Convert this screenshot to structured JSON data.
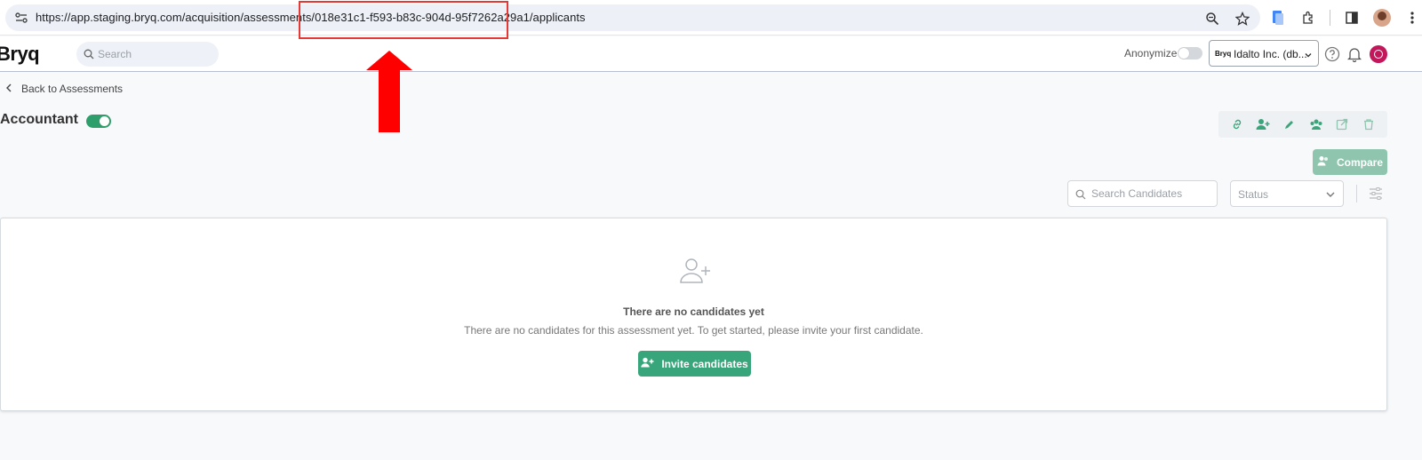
{
  "browser": {
    "url": "https://app.staging.bryq.com/acquisition/assessments/018e31c1-f593-b83c-904d-95f7262a29a1/applicants",
    "url_prefix": "https://app.staging.bryq.com/acquisition/assessments/",
    "url_id": "018e31c1-f593-b83c-904d-95f7262a29a1",
    "url_suffix": "/applicants"
  },
  "header": {
    "logo": "Bryq",
    "search_placeholder": "Search",
    "anonymize_label": "Anonymize",
    "anonymize_on": false,
    "org_logo": "Bryq",
    "org_name": "Idalto Inc. (db..."
  },
  "page": {
    "back_label": "Back to Assessments",
    "title": "Accountant",
    "active": true,
    "compare_label": "Compare",
    "candidate_search_placeholder": "Search Candidates",
    "status_placeholder": "Status"
  },
  "empty_state": {
    "title": "There are no candidates yet",
    "description": "There are no candidates for this assessment yet. To get started, please invite your first candidate.",
    "invite_label": "Invite candidates"
  },
  "colors": {
    "accent": "#38a57a",
    "highlight": "#e53935",
    "arrow": "#ff0000"
  }
}
